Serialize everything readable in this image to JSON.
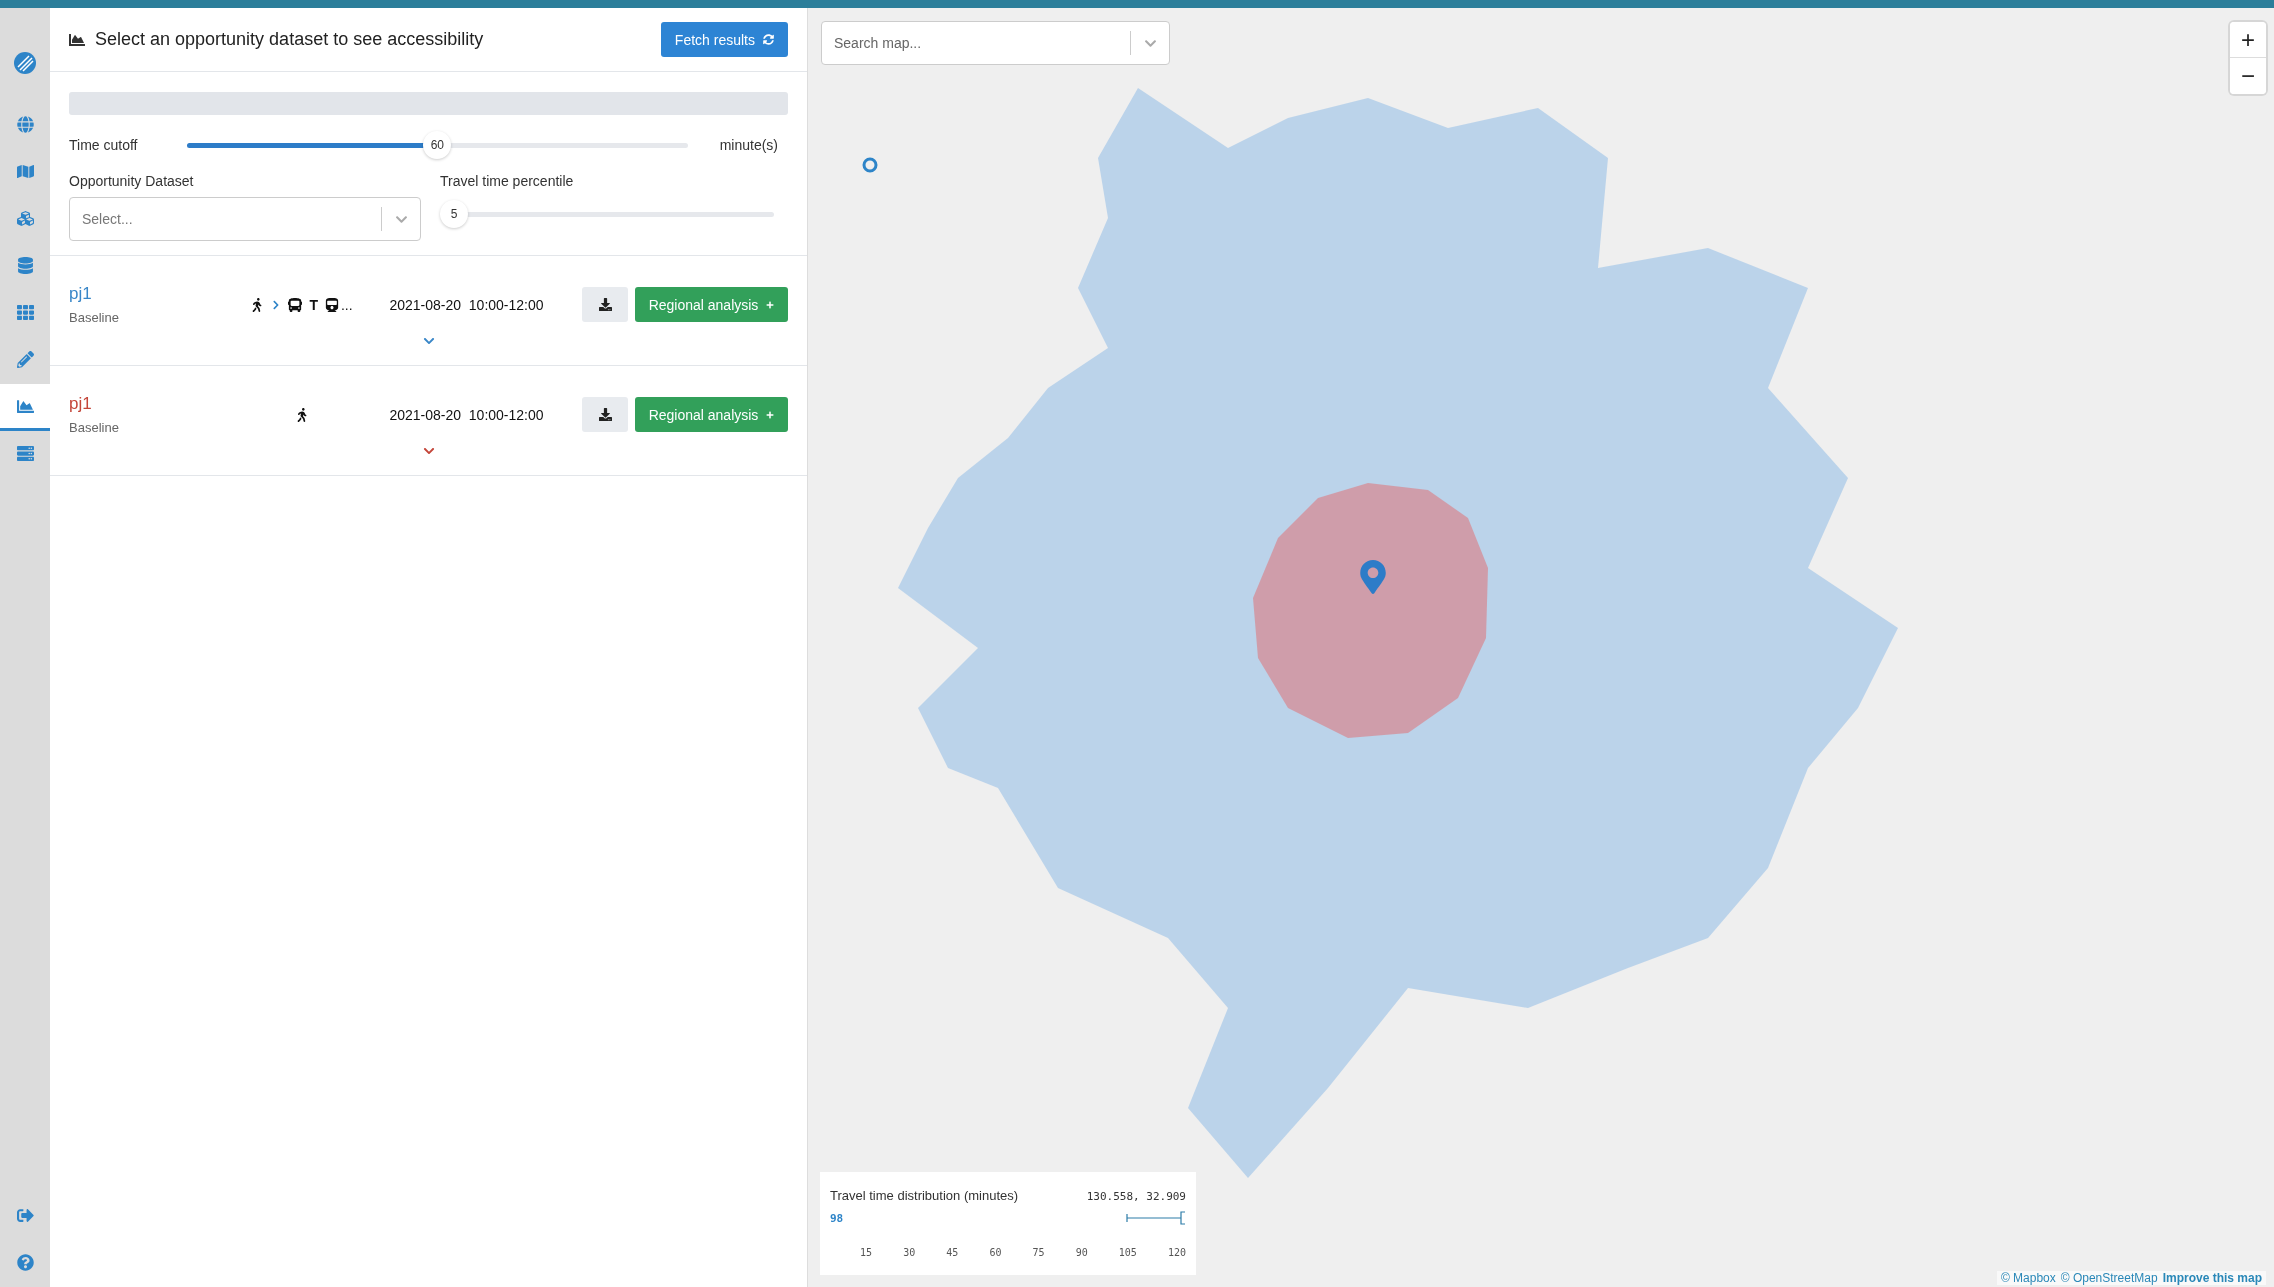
{
  "sidebar": {
    "items": [
      {
        "kind": "globe",
        "selected": false
      },
      {
        "kind": "map",
        "selected": false
      },
      {
        "kind": "cubes",
        "selected": false
      },
      {
        "kind": "database",
        "selected": false
      },
      {
        "kind": "grid",
        "selected": false
      },
      {
        "kind": "pencil",
        "selected": false
      },
      {
        "kind": "chart",
        "selected": true
      },
      {
        "kind": "server",
        "selected": false
      }
    ],
    "bottom_items": [
      {
        "kind": "signout",
        "selected": false
      },
      {
        "kind": "help",
        "selected": false
      }
    ]
  },
  "progress": {
    "level": 0
  },
  "header": {
    "title": "Select an opportunity dataset to see accessibility",
    "fetch_button": "Fetch results"
  },
  "time_cutoff": {
    "label": "Time cutoff",
    "value": "60",
    "level": 0.5,
    "unit": "minute(s)"
  },
  "opportunity_dataset": {
    "label": "Opportunity Dataset",
    "placeholder": "Select..."
  },
  "percentile": {
    "label": "Travel time percentile",
    "value": "5",
    "level": 0
  },
  "analyses": [
    {
      "name": "pj1",
      "color": "#3a87c8",
      "scenario": "Baseline",
      "modes": [
        {
          "kind": "walk"
        },
        {
          "kind": "bus"
        },
        {
          "kind": "letter",
          "text": "T"
        },
        {
          "kind": "rail"
        }
      ],
      "more": "...",
      "date": "2021-08-20",
      "time": "10:00-12:00",
      "button": "Regional analysis"
    },
    {
      "name": "pj1",
      "color": "#c4463a",
      "scenario": "Baseline",
      "modes": [
        {
          "kind": "walk"
        }
      ],
      "date": "2021-08-20",
      "time": "10:00-12:00",
      "button": "Regional analysis"
    }
  ],
  "map": {
    "search": {
      "placeholder": "Search map..."
    },
    "zoom_in": "+",
    "zoom_out": "−",
    "legend": {
      "title": "Travel time distribution (minutes)",
      "coords": "130.558, 32.909",
      "value": "98",
      "ticks": [
        "15",
        "30",
        "45",
        "60",
        "75",
        "90",
        "105",
        "120"
      ]
    },
    "attribution": [
      {
        "text": "© Mapbox",
        "bold": false
      },
      {
        "text": "© OpenStreetMap",
        "bold": false
      },
      {
        "text": "Improve this map",
        "bold": true
      }
    ]
  }
}
